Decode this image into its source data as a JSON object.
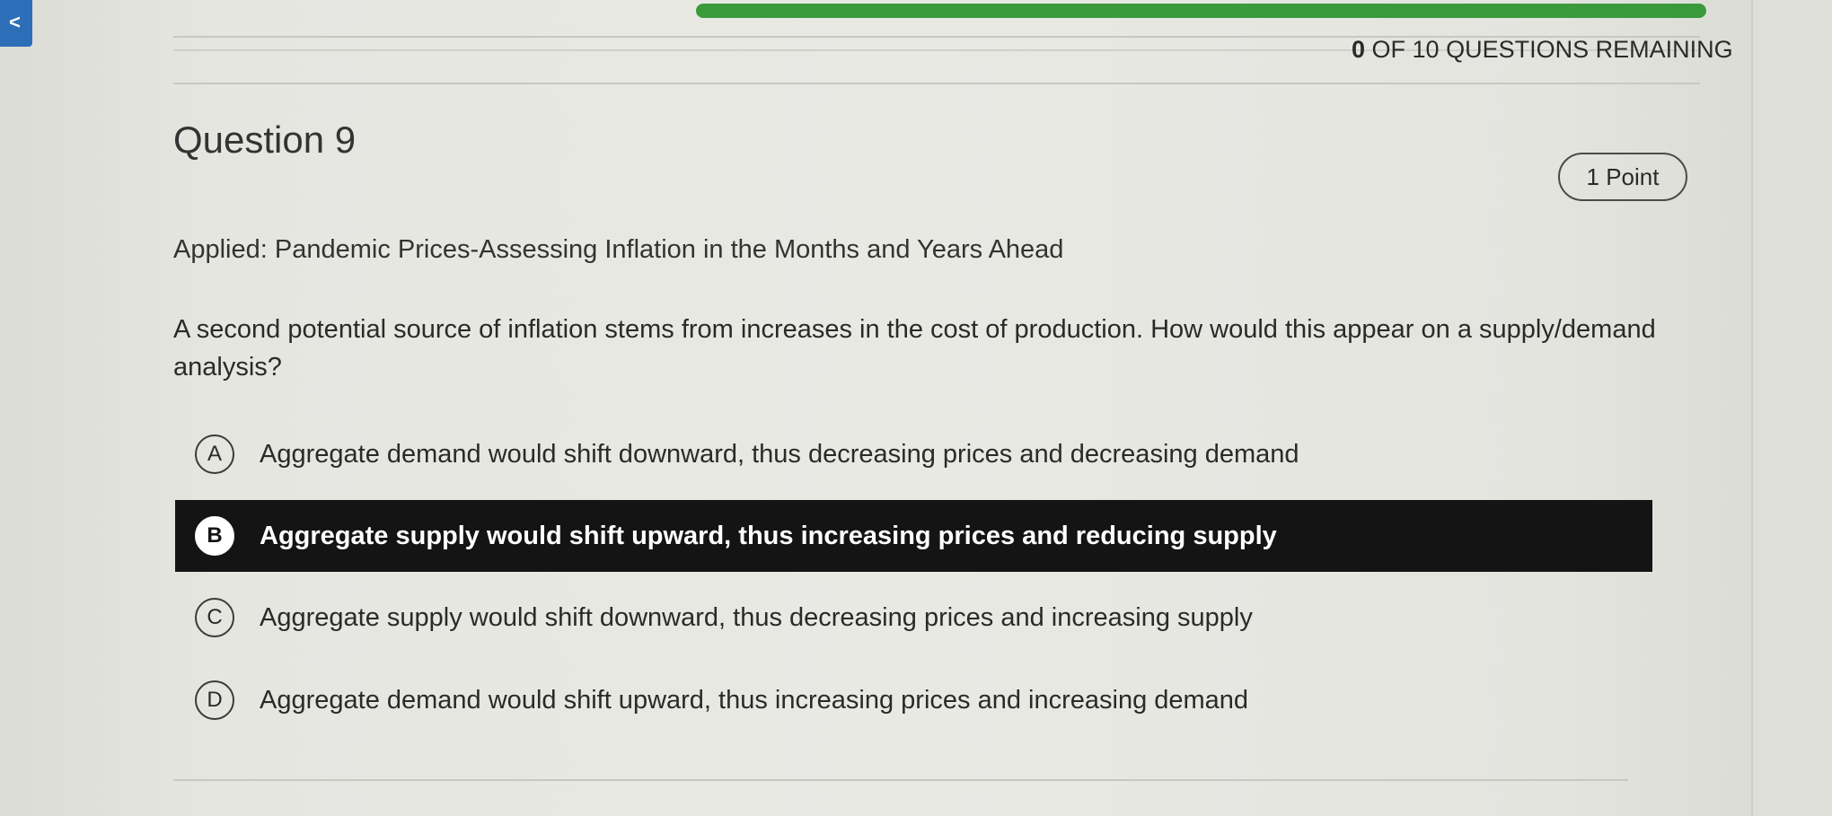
{
  "header": {
    "corner_glyph": "<",
    "remaining_count": "0",
    "remaining_text": "OF 10 QUESTIONS REMAINING",
    "progress_fraction": 0.66,
    "progress_color": "#3a9a3c"
  },
  "question": {
    "title": "Question 9",
    "points": "1 Point",
    "subtitle": "Applied: Pandemic Prices-Assessing Inflation in the Months and Years Ahead",
    "prompt": "A second potential source of inflation stems from increases in the cost of production. How would this appear on a supply/demand analysis?"
  },
  "options": [
    {
      "letter": "A",
      "text": "Aggregate demand would shift downward, thus decreasing prices and decreasing demand",
      "selected": false
    },
    {
      "letter": "B",
      "text": "Aggregate supply would shift upward, thus increasing prices and reducing supply",
      "selected": true
    },
    {
      "letter": "C",
      "text": "Aggregate supply would shift downward, thus decreasing prices and increasing supply",
      "selected": false
    },
    {
      "letter": "D",
      "text": "Aggregate demand would shift upward, thus increasing prices and increasing demand",
      "selected": false
    }
  ],
  "colors": {
    "selected_background": "#141414",
    "accent_blue": "#2c6fb8"
  }
}
